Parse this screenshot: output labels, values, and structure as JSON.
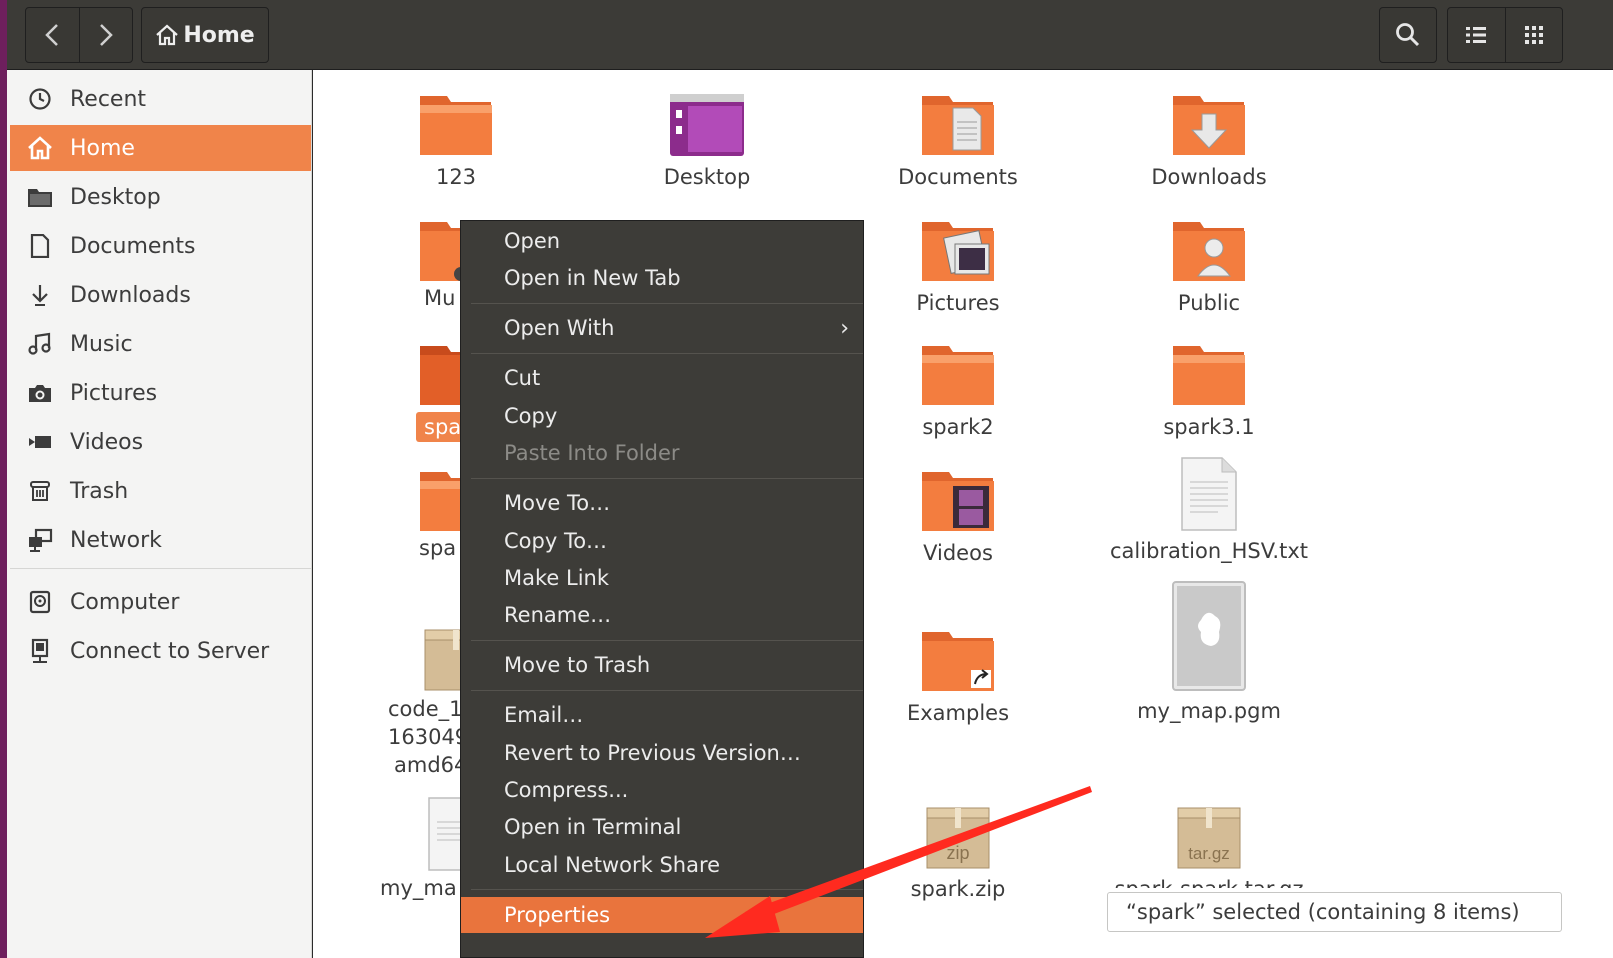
{
  "header": {
    "back_icon": "chevron-left-icon",
    "forward_icon": "chevron-right-icon",
    "path_label": "Home",
    "search_icon": "search-icon",
    "list_view_icon": "list-view-icon",
    "grid_view_icon": "grid-view-icon"
  },
  "sidebar": {
    "items": [
      {
        "label": "Recent",
        "icon": "clock-icon"
      },
      {
        "label": "Home",
        "icon": "home-icon",
        "active": true
      },
      {
        "label": "Desktop",
        "icon": "folder-icon"
      },
      {
        "label": "Documents",
        "icon": "document-icon"
      },
      {
        "label": "Downloads",
        "icon": "download-icon"
      },
      {
        "label": "Music",
        "icon": "music-icon"
      },
      {
        "label": "Pictures",
        "icon": "camera-icon"
      },
      {
        "label": "Videos",
        "icon": "video-icon"
      },
      {
        "label": "Trash",
        "icon": "trash-icon"
      },
      {
        "label": "Network",
        "icon": "network-icon"
      },
      {
        "label": "Computer",
        "icon": "drive-icon"
      },
      {
        "label": "Connect to Server",
        "icon": "server-icon"
      }
    ]
  },
  "files": {
    "f123": "123",
    "desktop": "Desktop",
    "documents": "Documents",
    "downloads": "Downloads",
    "music_partial": "Mu",
    "pictures": "Pictures",
    "public": "Public",
    "spark_partial": "spa",
    "spark2": "spark2",
    "spark31": "spark3.1",
    "spark_other_partial": "spa",
    "videos": "Videos",
    "calibration": "calibration_HSV.txt",
    "code_line1": "code_1",
    "code_line2": "163049",
    "code_line3": "amd64",
    "examples": "Examples",
    "my_map_pgm": "my_map.pgm",
    "my_map_partial": "my_ma",
    "spark_zip": "spark.zip",
    "zip_badge": "zip",
    "targz_badge": "tar.gz",
    "spark_targz_partial": "spark-spark.tar.gz"
  },
  "context_menu": {
    "open": "Open",
    "open_new_tab": "Open in New Tab",
    "open_with": "Open With",
    "cut": "Cut",
    "copy": "Copy",
    "paste_into_folder": "Paste Into Folder",
    "move_to": "Move To…",
    "copy_to": "Copy To…",
    "make_link": "Make Link",
    "rename": "Rename…",
    "move_to_trash": "Move to Trash",
    "email": "Email…",
    "revert": "Revert to Previous Version…",
    "compress": "Compress...",
    "open_terminal": "Open in Terminal",
    "local_network_share": "Local Network Share",
    "properties": "Properties"
  },
  "status": {
    "text": "“spark” selected  (containing 8 items)"
  },
  "colors": {
    "accent": "#f0844a",
    "folder": "#e8632a",
    "annotation_arrow": "#ff2a1f"
  }
}
